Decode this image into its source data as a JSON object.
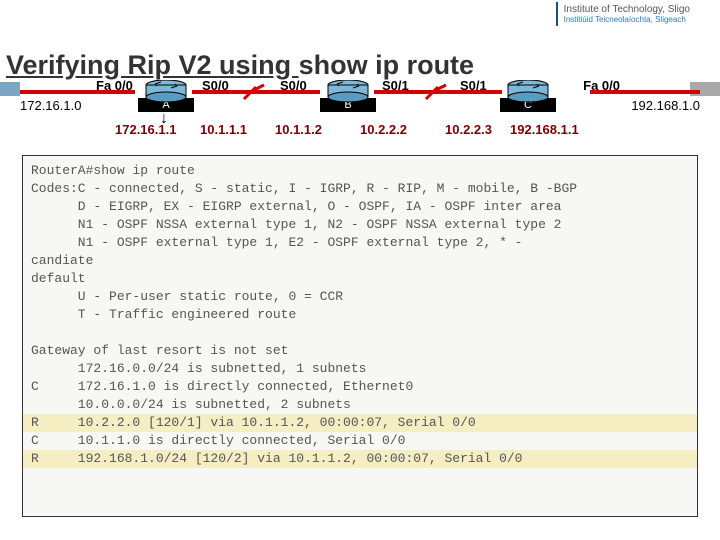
{
  "header": {
    "line1": "Institute of Technology, Sligo",
    "line2": "Institiúid Teicneolaíochta, Sligeach"
  },
  "title": {
    "part_under": "Verifying Rip V2 using ",
    "part_plain": "show ip route"
  },
  "topology": {
    "left_network": "172.16.1.0",
    "right_network": "192.168.1.0",
    "router_a": "A",
    "router_b": "B",
    "router_c": "C",
    "iface_fa00_left": "Fa 0/0",
    "iface_s00_a": "S0/0",
    "iface_s00_b": "S0/0",
    "iface_s01_b": "S0/1",
    "iface_s01_c": "S0/1",
    "iface_fa00_right": "Fa 0/0",
    "ip_a_left": "172.16.1.1",
    "ip_a_right": "10.1.1.1",
    "ip_b_left": "10.1.1.2",
    "ip_b_right": "10.2.2.2",
    "ip_c_left": "10.2.2.3",
    "ip_c_right": "192.168.1.1"
  },
  "terminal": {
    "t0": "RouterA#show ip route",
    "t1": "Codes:C - connected, S - static, I - IGRP, R - RIP, M - mobile, B -BGP",
    "t2": "      D - EIGRP, EX - EIGRP external, O - OSPF, IA - OSPF inter area",
    "t3": "      N1 - OSPF NSSA external type 1, N2 - OSPF NSSA external type 2",
    "t4": "      N1 - OSPF external type 1, E2 - OSPF external type 2, * -",
    "t5": "candiate",
    "t6": "default",
    "t7": "      U - Per-user static route, 0 = CCR",
    "t8": "      T - Traffic engineered route",
    "t9": "",
    "t10": "Gateway of last resort is not set",
    "t11": "      172.16.0.0/24 is subnetted, 1 subnets",
    "t12": "C     172.16.1.0 is directly connected, Ethernet0",
    "t13": "      10.0.0.0/24 is subnetted, 2 subnets",
    "t14": "R     10.2.2.0 [120/1] via 10.1.1.2, 00:00:07, Serial 0/0",
    "t15": "C     10.1.1.0 is directly connected, Serial 0/0",
    "t16": "R     192.168.1.0/24 [120/2] via 10.1.1.2, 00:00:07, Serial 0/0"
  }
}
